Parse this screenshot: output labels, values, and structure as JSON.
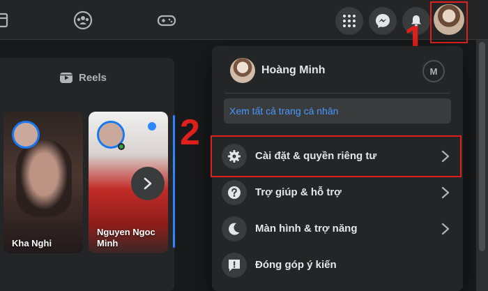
{
  "header": {
    "icons": [
      "gaming-icon",
      "groups-icon",
      "game-controller-icon",
      "menu-grid-icon",
      "messenger-icon",
      "notifications-icon",
      "account-avatar"
    ]
  },
  "annotations": {
    "step1": "1",
    "step2": "2",
    "highlight_color": "#e0201c"
  },
  "left_panel": {
    "reels_tab": "Reels",
    "stories": [
      {
        "name": "Kha Nghi"
      },
      {
        "name": "Nguyen Ngoc Minh"
      }
    ]
  },
  "account_menu": {
    "profile_name": "Hoàng Minh",
    "see_all_profiles": "Xem tất cả trang cá nhân",
    "items": [
      {
        "label": "Cài đặt & quyền riêng tư",
        "icon": "gear-icon",
        "has_submenu": true
      },
      {
        "label": "Trợ giúp & hỗ trợ",
        "icon": "help-icon",
        "has_submenu": true
      },
      {
        "label": "Màn hình & trợ năng",
        "icon": "moon-icon",
        "has_submenu": true
      },
      {
        "label": "Đóng góp ý kiến",
        "icon": "feedback-icon",
        "has_submenu": false
      }
    ]
  },
  "colors": {
    "background": "#18191a",
    "surface": "#242526",
    "accent_blue": "#4599ff"
  }
}
